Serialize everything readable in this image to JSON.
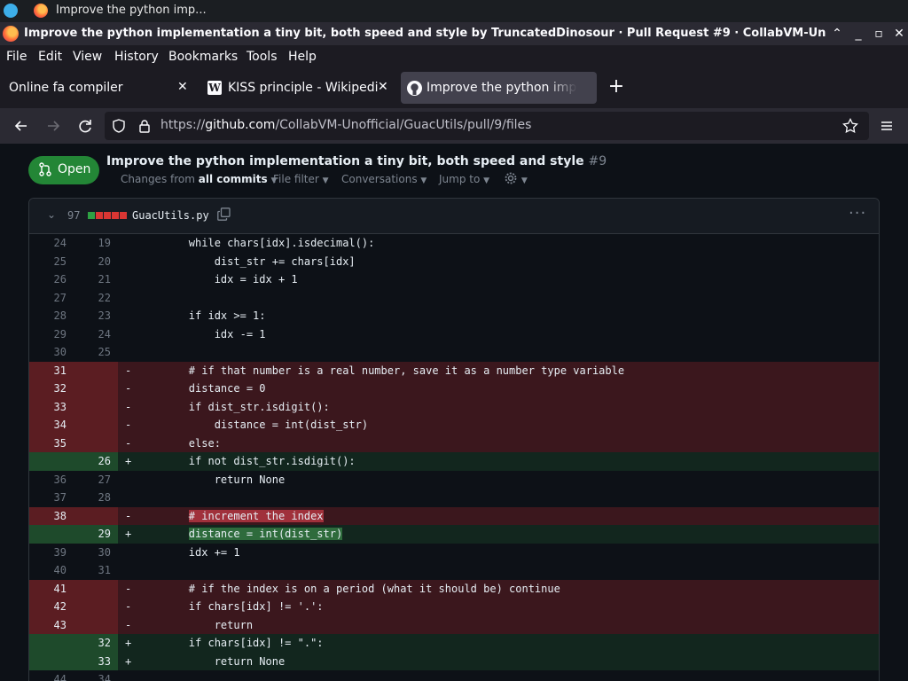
{
  "os_bar": {
    "window_label": "Improve the python imp..."
  },
  "window": {
    "title": "Improve the python implementation a tiny bit, both speed and style by TruncatedDinosour · Pull Request #9 · CollabVM-Unofficial/G"
  },
  "menu": [
    "File",
    "Edit",
    "View",
    "History",
    "Bookmarks",
    "Tools",
    "Help"
  ],
  "tabs": [
    {
      "label": "Online fa compiler",
      "favicon": "none"
    },
    {
      "label": "KISS principle - Wikipedia",
      "favicon": "wikipedia-icon"
    },
    {
      "label": "Improve the python impl",
      "favicon": "github-icon",
      "active": true
    }
  ],
  "nav": {
    "url_prefix": "https://",
    "url_host": "github.com",
    "url_path": "/CollabVM-Unofficial/GuacUtils/pull/9/files"
  },
  "pr": {
    "state": "Open",
    "title": "Improve the python implementation a tiny bit, both speed and style",
    "number": "#9",
    "toolbar": {
      "changes_prefix": "Changes from ",
      "changes_value": "all commits",
      "file_filter": "File filter",
      "conversations": "Conversations",
      "jump_to": "Jump to"
    }
  },
  "file": {
    "change_count": "97",
    "diffstat": [
      "add",
      "del",
      "del",
      "del",
      "del"
    ],
    "name": "GuacUtils.py"
  },
  "colors": {
    "open_green": "#238636",
    "del_bg": "#3b171d",
    "add_bg": "#12261e"
  },
  "diff_rows": [
    {
      "type": "ctx",
      "old": "24",
      "new": "19",
      "mark": "",
      "code": "        while chars[idx].isdecimal():"
    },
    {
      "type": "ctx",
      "old": "25",
      "new": "20",
      "mark": "",
      "code": "            dist_str += chars[idx]"
    },
    {
      "type": "ctx",
      "old": "26",
      "new": "21",
      "mark": "",
      "code": "            idx = idx + 1"
    },
    {
      "type": "ctx",
      "old": "27",
      "new": "22",
      "mark": "",
      "code": ""
    },
    {
      "type": "ctx",
      "old": "28",
      "new": "23",
      "mark": "",
      "code": "        if idx >= 1:"
    },
    {
      "type": "ctx",
      "old": "29",
      "new": "24",
      "mark": "",
      "code": "            idx -= 1"
    },
    {
      "type": "ctx",
      "old": "30",
      "new": "25",
      "mark": "",
      "code": ""
    },
    {
      "type": "del",
      "old": "31",
      "new": "",
      "mark": "-",
      "code": "        # if that number is a real number, save it as a number type variable"
    },
    {
      "type": "del",
      "old": "32",
      "new": "",
      "mark": "-",
      "code": "        distance = 0"
    },
    {
      "type": "del",
      "old": "33",
      "new": "",
      "mark": "-",
      "code": "        if dist_str.isdigit():"
    },
    {
      "type": "del",
      "old": "34",
      "new": "",
      "mark": "-",
      "code": "            distance = int(dist_str)"
    },
    {
      "type": "del",
      "old": "35",
      "new": "",
      "mark": "-",
      "code": "        else:"
    },
    {
      "type": "add",
      "old": "",
      "new": "26",
      "mark": "+",
      "code": "        if not dist_str.isdigit():"
    },
    {
      "type": "ctx",
      "old": "36",
      "new": "27",
      "mark": "",
      "code": "            return None"
    },
    {
      "type": "ctx",
      "old": "37",
      "new": "28",
      "mark": "",
      "code": ""
    },
    {
      "type": "del",
      "old": "38",
      "new": "",
      "mark": "-",
      "code": "        # increment the index",
      "highlight": true
    },
    {
      "type": "add",
      "old": "",
      "new": "29",
      "mark": "+",
      "code": "        distance = int(dist_str)",
      "highlight": true
    },
    {
      "type": "ctx",
      "old": "39",
      "new": "30",
      "mark": "",
      "code": "        idx += 1"
    },
    {
      "type": "ctx",
      "old": "40",
      "new": "31",
      "mark": "",
      "code": ""
    },
    {
      "type": "del",
      "old": "41",
      "new": "",
      "mark": "-",
      "code": "        # if the index is on a period (what it should be) continue"
    },
    {
      "type": "del",
      "old": "42",
      "new": "",
      "mark": "-",
      "code": "        if chars[idx] != '.':"
    },
    {
      "type": "del",
      "old": "43",
      "new": "",
      "mark": "-",
      "code": "            return"
    },
    {
      "type": "add",
      "old": "",
      "new": "32",
      "mark": "+",
      "code": "        if chars[idx] != \".\":"
    },
    {
      "type": "add",
      "old": "",
      "new": "33",
      "mark": "+",
      "code": "            return None"
    },
    {
      "type": "ctx",
      "old": "44",
      "new": "34",
      "mark": "",
      "code": ""
    }
  ]
}
